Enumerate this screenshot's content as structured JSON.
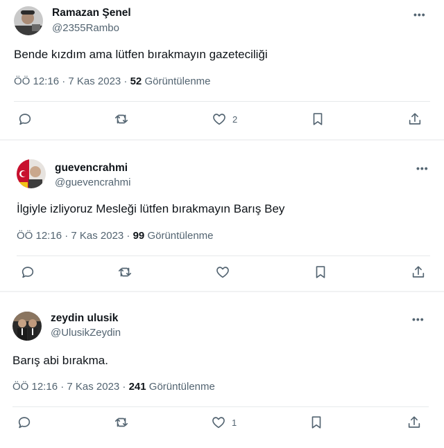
{
  "tweets": [
    {
      "name": "Ramazan Şenel",
      "handle": "@2355Rambo",
      "text": "Bende kızdım ama lütfen bırakmayın gazeteciliği",
      "time": "ÖÖ 12:16 · 7 Kas 2023 · ",
      "views_count": "52",
      "views_label": " Görüntülenme",
      "actions": {
        "reply": "",
        "retweet": "",
        "like": "2",
        "bookmark": "",
        "share": ""
      },
      "more_label": "•••"
    },
    {
      "name": "guevencrahmi",
      "handle": "@guevencrahmi",
      "text": "İlgiyle izliyoruz Mesleği lütfen bırakmayın Barış Bey",
      "time": "ÖÖ 12:16 · 7 Kas 2023 · ",
      "views_count": "99",
      "views_label": " Görüntülenme",
      "actions": {
        "reply": "",
        "retweet": "",
        "like": "",
        "bookmark": "",
        "share": ""
      },
      "more_label": "•••"
    },
    {
      "name": "zeydin ulusik",
      "handle": "@UlusikZeydin",
      "text": "Barış abi bırakma.",
      "time": "ÖÖ 12:16 · 7 Kas 2023 · ",
      "views_count": "241",
      "views_label": " Görüntülenme",
      "actions": {
        "reply": "",
        "retweet": "",
        "like": "1",
        "bookmark": "",
        "share": ""
      },
      "more_label": "•••"
    }
  ],
  "icons": {
    "reply": "reply-icon",
    "retweet": "retweet-icon",
    "like": "heart-icon",
    "bookmark": "bookmark-icon",
    "share": "share-icon"
  },
  "colors": {
    "text": "#0f1419",
    "secondary": "#536471",
    "divider": "#e6e9eb"
  }
}
